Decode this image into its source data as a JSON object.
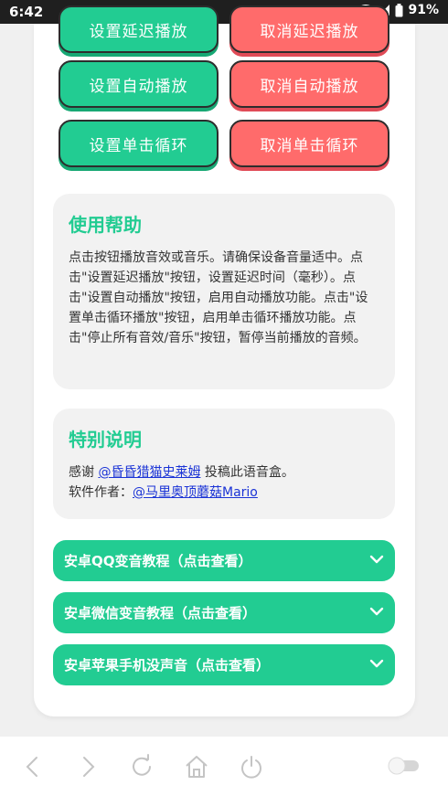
{
  "status": {
    "time": "6:42",
    "battery": "91%"
  },
  "buttons": {
    "set_delay": "设置延迟播放",
    "cancel_delay": "取消延迟播放",
    "set_auto": "设置自动播放",
    "cancel_auto": "取消自动播放",
    "set_loop": "设置单击循环",
    "cancel_loop": "取消单击循环"
  },
  "help": {
    "title": "使用帮助",
    "text": "点击按钮播放音效或音乐。请确保设备音量适中。点击\"设置延迟播放\"按钮，设置延迟时间（毫秒）。点击\"设置自动播放\"按钮，启用自动播放功能。点击\"设置单击循环播放\"按钮，启用单击循环播放功能。点击\"停止所有音效/音乐\"按钮，暂停当前播放的音频。"
  },
  "special": {
    "title": "特别说明",
    "thanks_prefix": "感谢",
    "thanks_link": "@昏昏猎猫史莱姆",
    "thanks_suffix": " 投稿此语音盒。",
    "author_prefix": "软件作者：",
    "author_link": "@马里奥顶蘑菇Mario"
  },
  "accordions": [
    {
      "label": "安卓QQ变音教程（点击查看）"
    },
    {
      "label": "安卓微信变音教程（点击查看）"
    },
    {
      "label": "安卓苹果手机没声音（点击查看）"
    }
  ],
  "colors": {
    "green": "#22cc92",
    "red": "#ff6b6b",
    "link": "#1a33d6"
  }
}
